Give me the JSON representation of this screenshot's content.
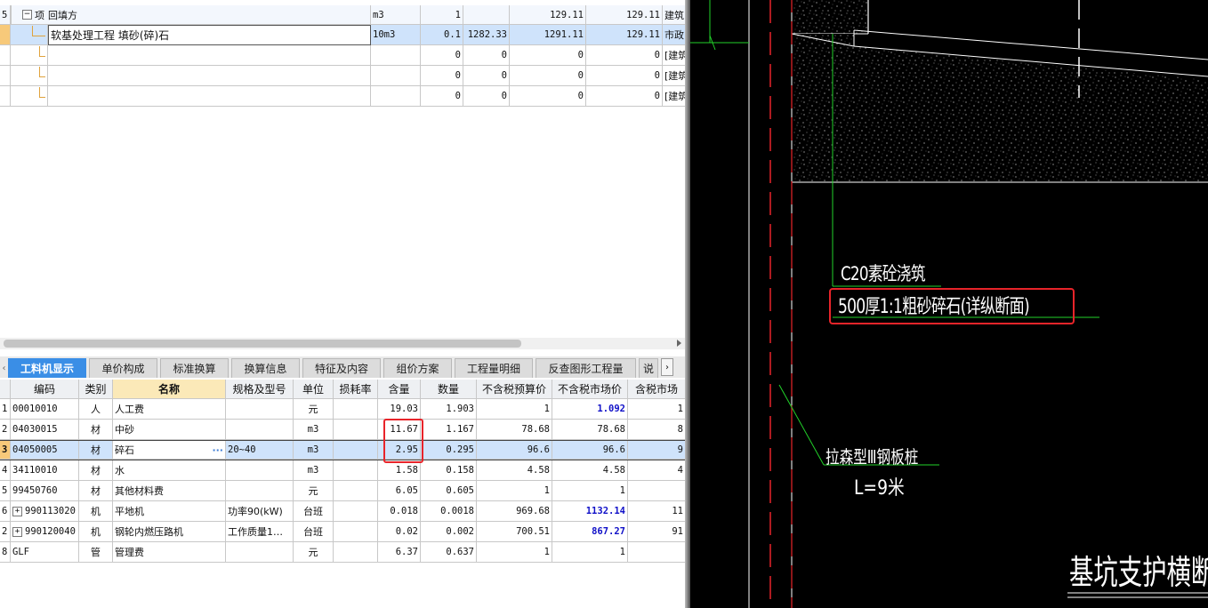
{
  "top_rows": [
    {
      "idx": "5",
      "type": "项",
      "name": "回填方",
      "unit": "m3",
      "qty": "1",
      "price": "",
      "total": "129.11",
      "tax": "129.11",
      "cat": "建筑"
    },
    {
      "idx": "",
      "type": "",
      "name": "软基处理工程 填砂(碎)石",
      "unit": "10m3",
      "qty": "0.1",
      "price": "1282.33",
      "total": "1291.11",
      "tax": "129.11",
      "cat": "市政"
    },
    {
      "idx": "",
      "type": "",
      "name": "",
      "unit": "",
      "qty": "0",
      "price": "0",
      "total": "0",
      "tax": "0",
      "cat": "[建筑"
    },
    {
      "idx": "",
      "type": "",
      "name": "",
      "unit": "",
      "qty": "0",
      "price": "0",
      "total": "0",
      "tax": "0",
      "cat": "[建筑"
    },
    {
      "idx": "",
      "type": "",
      "name": "",
      "unit": "",
      "qty": "0",
      "price": "0",
      "total": "0",
      "tax": "0",
      "cat": "[建筑"
    }
  ],
  "tabs": [
    "工料机显示",
    "单价构成",
    "标准换算",
    "换算信息",
    "特征及内容",
    "组价方案",
    "工程量明细",
    "反查图形工程量",
    "说"
  ],
  "columns": [
    "编码",
    "类别",
    "名称",
    "规格及型号",
    "单位",
    "损耗率",
    "含量",
    "数量",
    "不含税预算价",
    "不含税市场价",
    "含税市场"
  ],
  "resources": [
    {
      "idx": "1",
      "code": "00010010",
      "cat": "人",
      "name": "人工费",
      "spec": "",
      "unit": "元",
      "loss": "",
      "content": "19.03",
      "amount": "1.903",
      "budget": "1",
      "market": "1.092",
      "taxm": "1",
      "blue": true
    },
    {
      "idx": "2",
      "code": "04030015",
      "cat": "材",
      "name": "中砂",
      "spec": "",
      "unit": "m3",
      "loss": "",
      "content": "11.67",
      "amount": "1.167",
      "budget": "78.68",
      "market": "78.68",
      "taxm": "8",
      "blue": false
    },
    {
      "idx": "3",
      "code": "04050005",
      "cat": "材",
      "name": "碎石",
      "spec": "20~40",
      "unit": "m3",
      "loss": "",
      "content": "2.95",
      "amount": "0.295",
      "budget": "96.6",
      "market": "96.6",
      "taxm": "9",
      "blue": false
    },
    {
      "idx": "4",
      "code": "34110010",
      "cat": "材",
      "name": "水",
      "spec": "",
      "unit": "m3",
      "loss": "",
      "content": "1.58",
      "amount": "0.158",
      "budget": "4.58",
      "market": "4.58",
      "taxm": "4",
      "blue": false
    },
    {
      "idx": "5",
      "code": "99450760",
      "cat": "材",
      "name": "其他材料费",
      "spec": "",
      "unit": "元",
      "loss": "",
      "content": "6.05",
      "amount": "0.605",
      "budget": "1",
      "market": "1",
      "taxm": "",
      "blue": false
    },
    {
      "idx": "6",
      "code": "990113020",
      "cat": "机",
      "name": "平地机",
      "spec": "功率90(kW)",
      "unit": "台班",
      "loss": "",
      "content": "0.018",
      "amount": "0.0018",
      "budget": "969.68",
      "market": "1132.14",
      "taxm": "11",
      "blue": true
    },
    {
      "idx": "2",
      "code": "990120040",
      "cat": "机",
      "name": "钢轮内燃压路机",
      "spec": "工作质量1…",
      "unit": "台班",
      "loss": "",
      "content": "0.02",
      "amount": "0.002",
      "budget": "700.51",
      "market": "867.27",
      "taxm": "91",
      "blue": true
    },
    {
      "idx": "8",
      "code": "GLF",
      "cat": "管",
      "name": "管理费",
      "spec": "",
      "unit": "元",
      "loss": "",
      "content": "6.37",
      "amount": "0.637",
      "budget": "1",
      "market": "1",
      "taxm": "",
      "blue": false
    }
  ],
  "cad": {
    "label_c20": "C20素砼浇筑",
    "label_sand": "500厚1:1粗砂碎石(详纵断面)",
    "label_pile": "拉森型Ⅲ钢板桩",
    "label_length": "L=9米",
    "label_title": "基坑支护横断面",
    "colors": {
      "red": "#e8242a",
      "green": "#22d22a",
      "white": "#ffffff"
    }
  },
  "ellipsis": "···"
}
